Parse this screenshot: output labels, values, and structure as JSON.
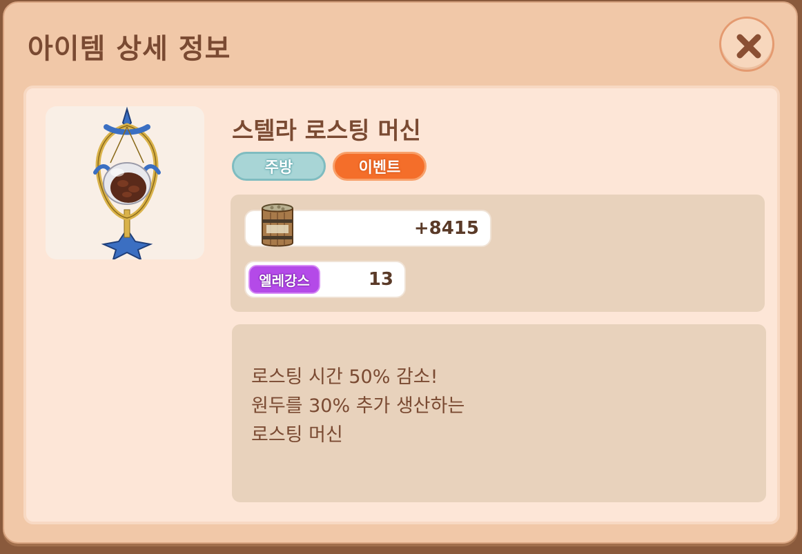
{
  "dialog": {
    "title": "아이템 상세 정보",
    "close_icon": "close-icon"
  },
  "item": {
    "name": "스텔라 로스팅 머신",
    "image_icon": "roasting-machine-icon",
    "tags": [
      {
        "label": "주방",
        "color": "#a8d5d6"
      },
      {
        "label": "이벤트",
        "color": "#f46e2a"
      }
    ],
    "stats": [
      {
        "icon": "coffee-bean-barrel-icon",
        "value": "+8415"
      },
      {
        "badge": "엘레강스",
        "value": "13",
        "badge_color": "#b44ae8"
      }
    ],
    "description": [
      "로스팅 시간 50% 감소!",
      "원두를 30% 추가 생산하는",
      "로스팅 머신"
    ]
  }
}
